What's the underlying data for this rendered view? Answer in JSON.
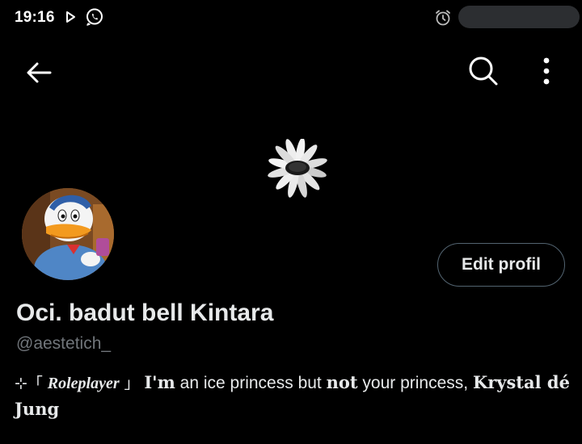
{
  "status_bar": {
    "time": "19:16",
    "icons": [
      "play-icon",
      "whatsapp-icon",
      "alarm-icon"
    ]
  },
  "header": {
    "back_icon": "arrow-left-icon",
    "search_icon": "search-icon",
    "more_icon": "more-vertical-icon"
  },
  "profile": {
    "edit_button_label": "Edit profil",
    "display_name": "Oci. badut bell Kintara",
    "handle": "@aestetich_",
    "bio": {
      "prefix": "⊹「",
      "tag": "Roleplayer",
      "close_bracket": "」",
      "part1": "I'm",
      "part2": " an ice princess but ",
      "part3": "not",
      "part4": " your princess, ",
      "part5": "Krystal dé Jung"
    }
  },
  "colors": {
    "background": "#000000",
    "text_primary": "#e7e9ea",
    "text_secondary": "#71767b",
    "border": "#536471"
  }
}
